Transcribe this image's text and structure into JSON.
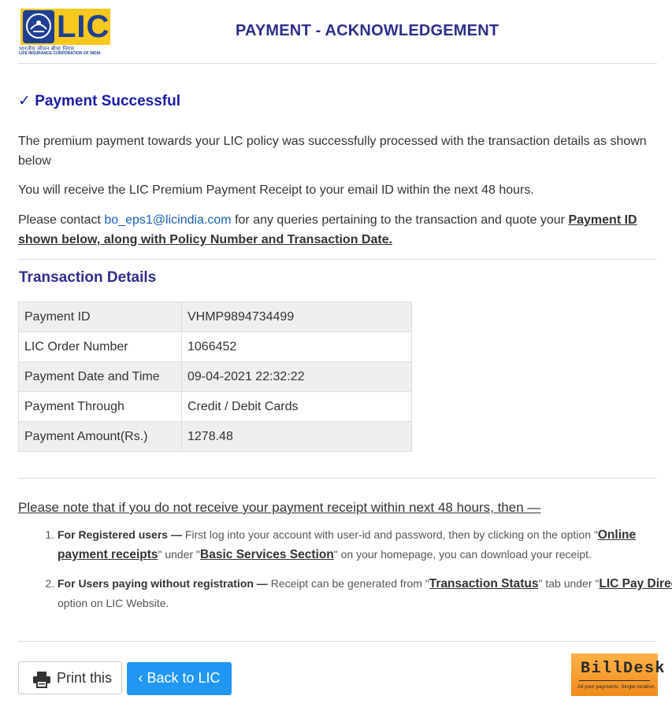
{
  "header": {
    "logo_text": "LIC",
    "logo_hindi": "भारतीय जीवन बीमा निगम",
    "logo_subtitle": "LIFE INSURANCE CORPORATION OF INDIA",
    "title": "PAYMENT - ACKNOWLEDGEMENT"
  },
  "status": {
    "check_icon": "✓",
    "text": "Payment Successful",
    "color": "#1a1aa6"
  },
  "messages": {
    "processed": "The premium payment towards your LIC policy was successfully processed with the transaction details as shown below",
    "receipt": "You will receive the LIC Premium Payment Receipt to your email ID within the next 48 hours.",
    "contact_prefix": "Please contact ",
    "contact_email": "bo_eps1@licindia.com",
    "contact_middle": " for any queries pertaining to the transaction and quote your ",
    "contact_emphasis": "Payment ID shown below, along with Policy Number and Transaction Date."
  },
  "transaction": {
    "title": "Transaction Details",
    "rows": [
      {
        "label": "Payment ID",
        "value": "VHMP9894734499"
      },
      {
        "label": "LIC Order Number",
        "value": "1066452"
      },
      {
        "label": "Payment Date and Time",
        "value": "09-04-2021 22:32:22"
      },
      {
        "label": "Payment Through",
        "value": "Credit / Debit Cards"
      },
      {
        "label": "Payment Amount(Rs.)",
        "value": "1278.48"
      }
    ]
  },
  "note": {
    "heading": "Please note that if you do not receive your payment receipt within next 48 hours, then —",
    "items": [
      {
        "lead": "For Registered users —",
        "t1": " First log into your account with user-id and password, then by clicking on the option \"",
        "link1": "Online payment receipts",
        "t2": "\" under \"",
        "link2": "Basic Services Section",
        "t3": "\" on your homepage, you can download your receipt."
      },
      {
        "lead": "For Users paying without registration —",
        "t1": " Receipt can be generated from \"",
        "link1": "Transaction Status",
        "t2": "\" tab under \"",
        "link2": "LIC Pay Direct",
        "t3": "\" option on LIC Website."
      }
    ]
  },
  "actions": {
    "print_label": "Print this",
    "print_icon": "printer-icon",
    "back_label": "‹ Back to LIC",
    "back_color": "#2196f3"
  },
  "partner": {
    "wordmark": "BillDesk",
    "tagline": "All your payments. Single location."
  }
}
